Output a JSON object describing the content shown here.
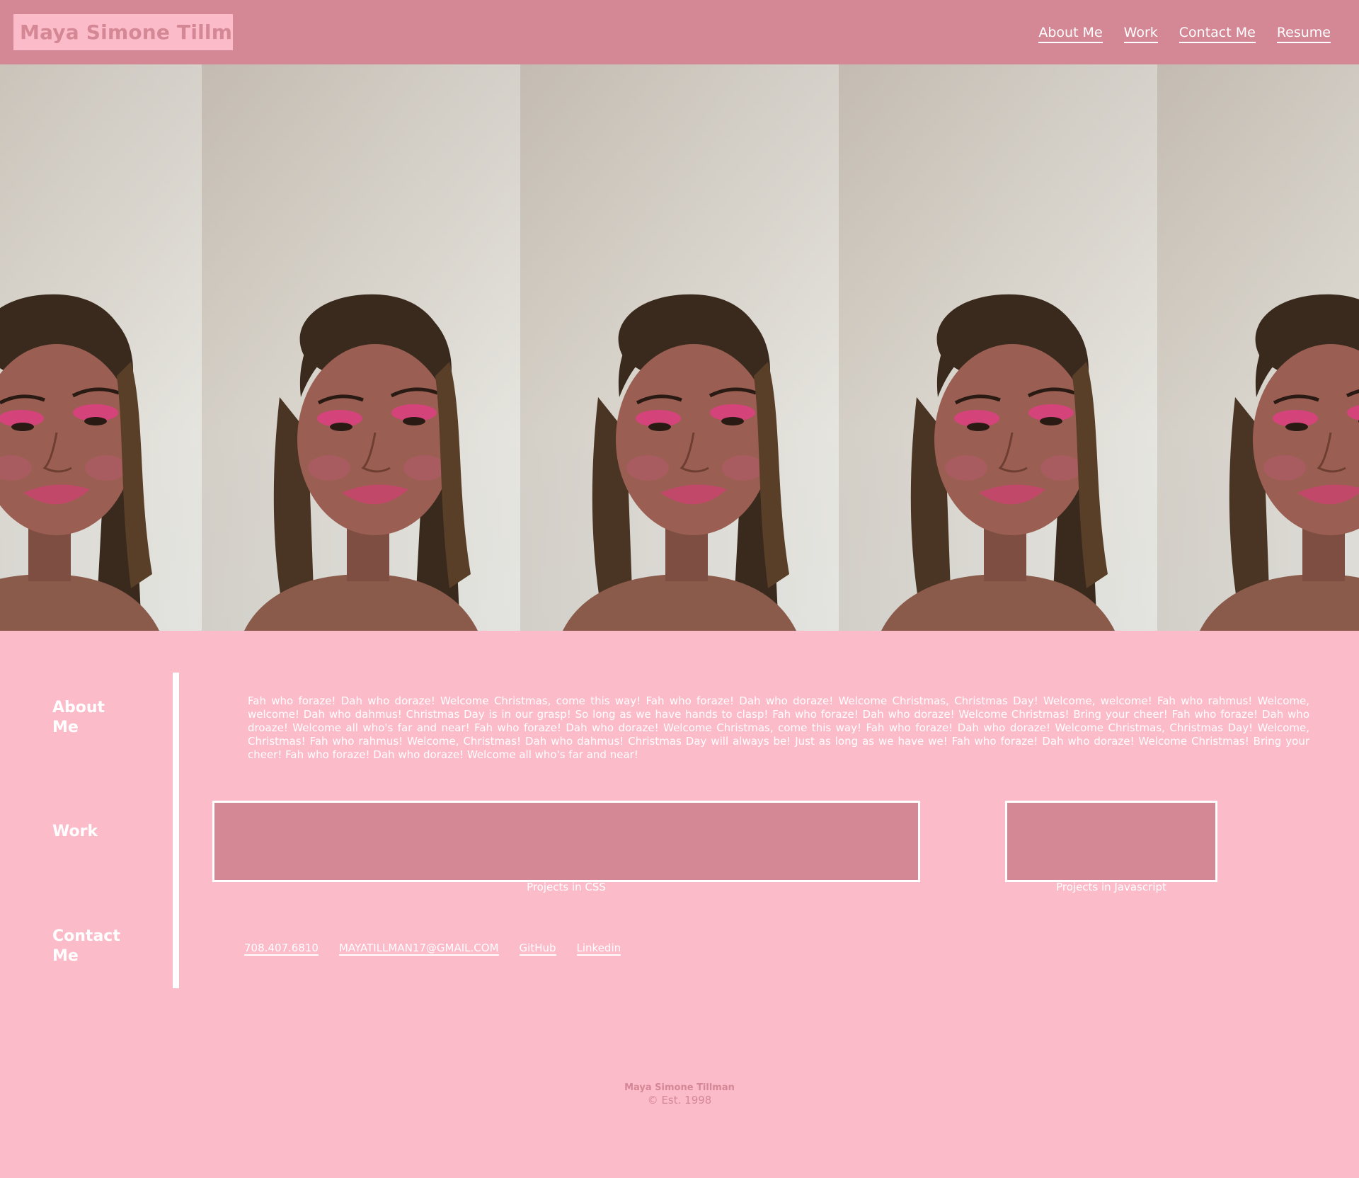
{
  "header": {
    "site_name": "Maya Simone Tillman",
    "nav": [
      {
        "label": "About Me"
      },
      {
        "label": "Work"
      },
      {
        "label": "Contact Me"
      },
      {
        "label": "Resume"
      }
    ]
  },
  "hero": {
    "image_description": "repeated portrait photo strip",
    "tile_count": 5
  },
  "sections": {
    "about_label": "About Me",
    "work_label": "Work",
    "contact_label": "Contact Me"
  },
  "about": {
    "text": "Fah who foraze! Dah who doraze! Welcome Christmas, come this way! Fah who foraze! Dah who doraze! Welcome Christmas, Christmas Day! Welcome, welcome! Fah who rahmus! Welcome, welcome! Dah who dahmus! Christmas Day is in our grasp! So long as we have hands to clasp! Fah who foraze! Dah who doraze! Welcome Christmas! Bring your cheer! Fah who foraze! Dah who droaze! Welcome all who's far and near! Fah who foraze! Dah who doraze! Welcome Christmas, come this way! Fah who foraze! Dah who doraze! Welcome Christmas, Christmas Day! Welcome, Christmas! Fah who rahmus! Welcome, Christmas! Dah who dahmus! Christmas Day will always be! Just as long as we have we! Fah who foraze! Dah who doraze! Welcome Christmas! Bring your cheer! Fah who foraze! Dah who doraze! Welcome all who's far and near!"
  },
  "work": {
    "projects": [
      {
        "caption": "Projects in CSS"
      },
      {
        "caption": "Projects in Javascript"
      }
    ]
  },
  "contact": {
    "links": [
      {
        "label": "708.407.6810"
      },
      {
        "label": "MAYATILLMAN17@GMAIL.COM"
      },
      {
        "label": "GitHub"
      },
      {
        "label": "Linkedin"
      }
    ]
  },
  "footer": {
    "name": "Maya Simone Tillman",
    "established": "© Est. 1998"
  },
  "colors": {
    "page_bg": "#fcbbc9",
    "accent": "#d48795",
    "text_light": "#ffffff"
  }
}
